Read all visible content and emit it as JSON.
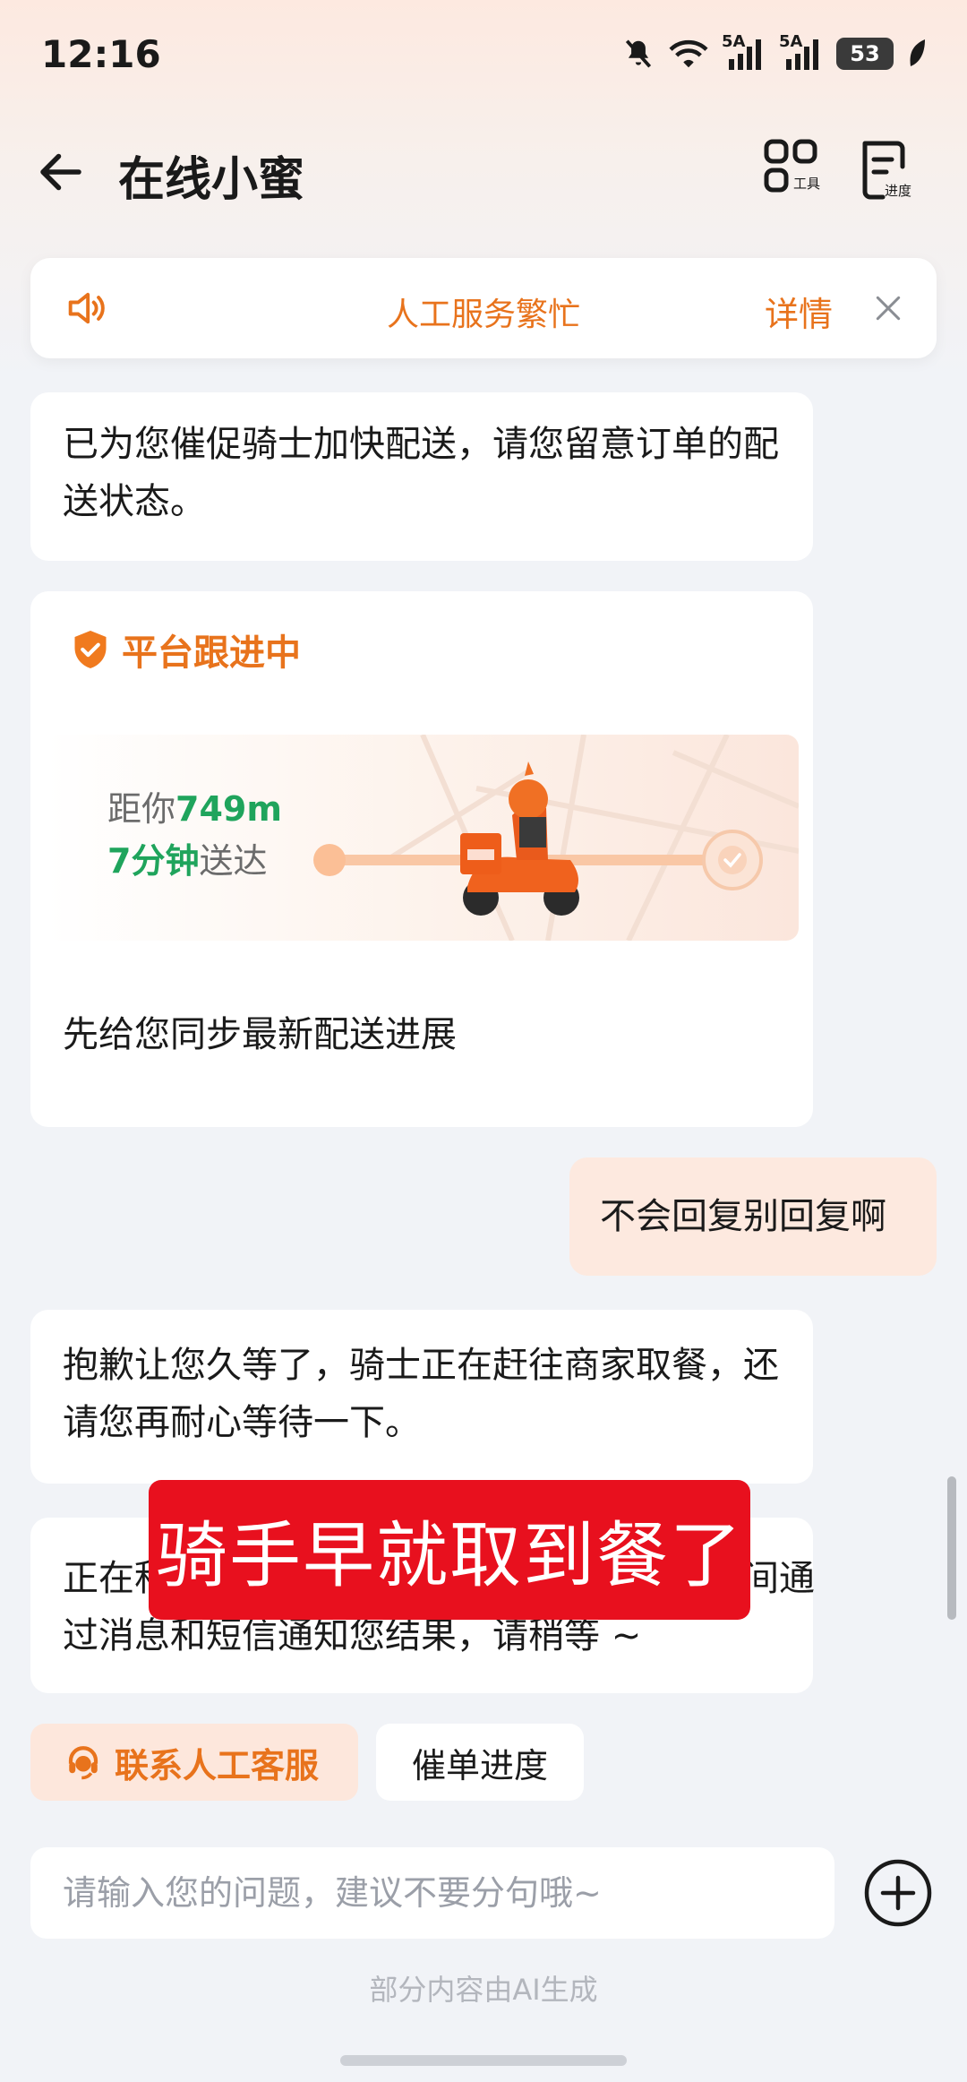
{
  "status_bar": {
    "time": "12:16",
    "signal1": "5A",
    "signal2": "5A",
    "battery": "53"
  },
  "nav": {
    "title": "在线小蜜",
    "tool_label": "工具",
    "progress_label": "进度"
  },
  "notice": {
    "text": "人工服务繁忙",
    "detail": "详情"
  },
  "messages": {
    "m1": "已为您催促骑士加快配送，请您留意订单的配送状态。",
    "follow_title": "平台跟进中",
    "distance_prefix": "距你",
    "distance_value": "749m",
    "eta_value": "7分钟",
    "eta_suffix": "送达",
    "sync": "先给您同步最新配送进展",
    "user": "不会回复别回复啊",
    "m3": "抱歉让您久等了，骑士正在赶往商家取餐，还请您再耐心等待一下。",
    "m4": "正在积极为您处理中，处理完成后会第一时间通过消息和短信通知您结果，请稍等 ~"
  },
  "overlay_caption": "骑手早就取到餐了",
  "chips": {
    "contact": "联系人工客服",
    "progress": "催单进度"
  },
  "input": {
    "placeholder": "请输入您的问题，建议不要分句哦~"
  },
  "footer_note": "部分内容由AI生成",
  "colors": {
    "accent": "#e8731c",
    "green": "#1fa45c",
    "caption_red": "#e8101e"
  }
}
